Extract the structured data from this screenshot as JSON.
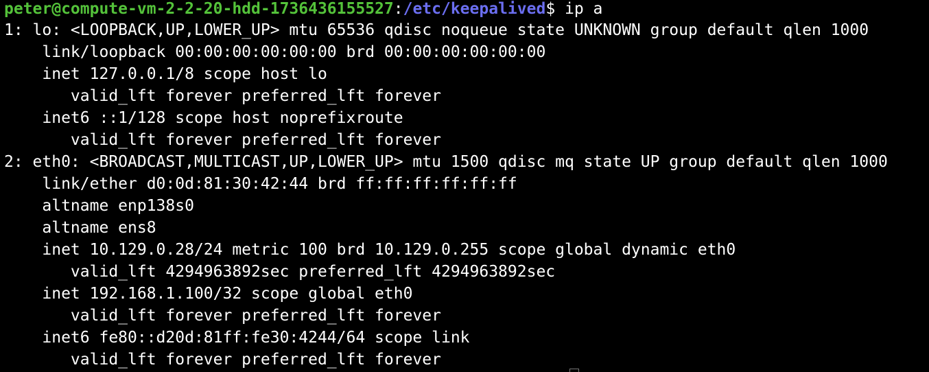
{
  "prompt": {
    "user_host": "peter@compute-vm-2-2-20-hdd-1736436155527",
    "separator": ":",
    "cwd": "/etc/keepalived",
    "symbol": "$",
    "command": " ip a"
  },
  "output_lines": [
    "1: lo: <LOOPBACK,UP,LOWER_UP> mtu 65536 qdisc noqueue state UNKNOWN group default qlen 1000",
    "    link/loopback 00:00:00:00:00:00 brd 00:00:00:00:00:00",
    "    inet 127.0.0.1/8 scope host lo",
    "       valid_lft forever preferred_lft forever",
    "    inet6 ::1/128 scope host noprefixroute",
    "       valid_lft forever preferred_lft forever",
    "2: eth0: <BROADCAST,MULTICAST,UP,LOWER_UP> mtu 1500 qdisc mq state UP group default qlen 1000",
    "    link/ether d0:0d:81:30:42:44 brd ff:ff:ff:ff:ff:ff",
    "    altname enp138s0",
    "    altname ens8",
    "    inet 10.129.0.28/24 metric 100 brd 10.129.0.255 scope global dynamic eth0",
    "       valid_lft 4294963892sec preferred_lft 4294963892sec",
    "    inet 192.168.1.100/32 scope global eth0",
    "       valid_lft forever preferred_lft forever",
    "    inet6 fe80::d20d:81ff:fe30:4244/64 scope link",
    "       valid_lft forever preferred_lft forever"
  ],
  "colors": {
    "background": "#000000",
    "text": "#ffffff",
    "user_host": "#54c23a",
    "cwd": "#6b6ef0"
  }
}
